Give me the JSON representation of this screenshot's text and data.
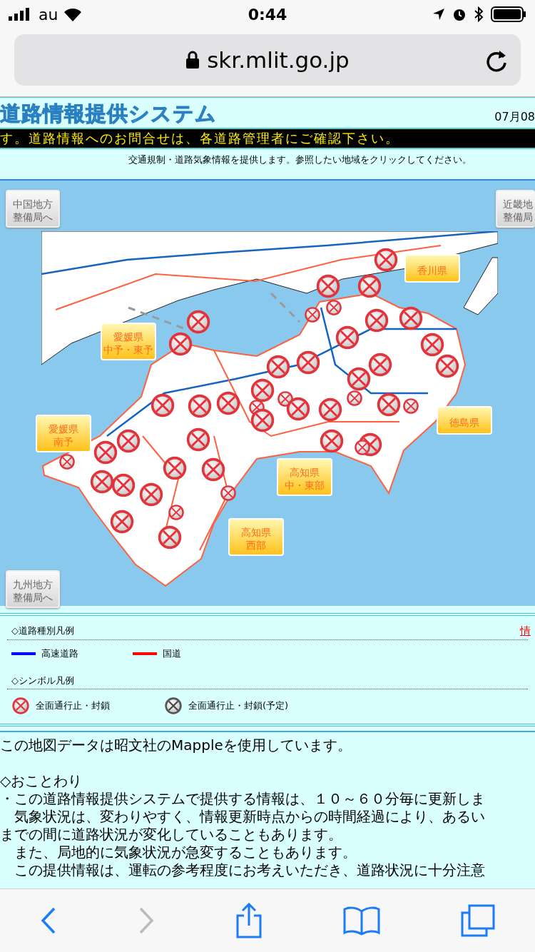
{
  "status_bar": {
    "carrier": "au",
    "time": "0:44"
  },
  "address_bar": {
    "url": "skr.mlit.go.jp"
  },
  "header": {
    "title": "道路情報提供システム",
    "date": "07月08"
  },
  "ticker": "す。道路情報へのお問合せは、各道路管理者にご確認下さい。",
  "intro": "交通規制・道路気象情報を提供します。参照したい地域をクリックしてください。",
  "map": {
    "region_buttons": [
      {
        "kind": "bureau",
        "lines": [
          "中国地方",
          "整備局へ"
        ]
      },
      {
        "kind": "bureau",
        "lines": [
          "近畿地",
          "整備局"
        ]
      },
      {
        "kind": "prefecture",
        "lines": [
          "香川県"
        ]
      },
      {
        "kind": "prefecture",
        "lines": [
          "愛媛県",
          "中予・東予"
        ]
      },
      {
        "kind": "prefecture",
        "lines": [
          "愛媛県",
          "南予"
        ]
      },
      {
        "kind": "prefecture",
        "lines": [
          "徳島県"
        ]
      },
      {
        "kind": "prefecture",
        "lines": [
          "高知県",
          "中・東部"
        ]
      },
      {
        "kind": "prefecture",
        "lines": [
          "高知県",
          "西部"
        ]
      },
      {
        "kind": "bureau",
        "lines": [
          "九州地方",
          "整備局へ"
        ]
      }
    ]
  },
  "legend": {
    "road_title": "◇道路種別凡例",
    "link": "情",
    "road_types": [
      {
        "label": "高速道路",
        "color": "#0000ff"
      },
      {
        "label": "国道",
        "color": "#ff0000"
      }
    ],
    "symbol_title": "◇シンボル凡例",
    "symbols": [
      {
        "kind": "closed",
        "label": "全面通行止・封鎖"
      },
      {
        "kind": "planned",
        "label": "全面通行止・封鎖(予定)"
      }
    ]
  },
  "notes": {
    "credit": "この地図データは昭文社のMappleを使用しています。",
    "heading": "◇おことわり",
    "lines": [
      "・この道路情報提供システムで提供する情報は、１０～６０分毎に更新しま",
      "　気象状況は、変わりやすく、情報更新時点からの時間経過により、あるい",
      "までの間に道路状況が変化していることもあります。",
      "　また、局地的に気象状況が急変することもあります。",
      "　この提供情報は、運転の参考程度にお考えいただき、道路状況に十分注意"
    ]
  },
  "toolbar": [
    {
      "kind": "back",
      "disabled": false
    },
    {
      "kind": "forward",
      "disabled": true
    },
    {
      "kind": "share",
      "disabled": false
    },
    {
      "kind": "bookmarks",
      "disabled": false
    },
    {
      "kind": "tabs",
      "disabled": false
    }
  ]
}
